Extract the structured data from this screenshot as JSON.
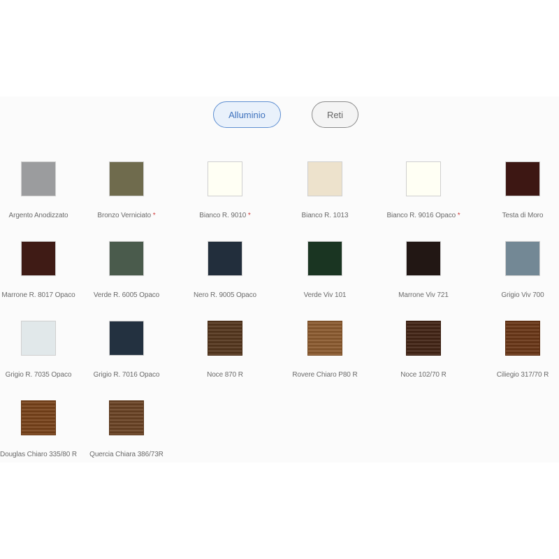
{
  "tabs": [
    {
      "label": "Alluminio",
      "active": true
    },
    {
      "label": "Reti",
      "active": false
    }
  ],
  "swatches": [
    {
      "label": "Argento Anodizzato",
      "color": "#9b9c9e",
      "star": false
    },
    {
      "label": "Bronzo Verniciato",
      "color": "#6f6b4d",
      "star": true
    },
    {
      "label": "Bianco R. 9010",
      "color": "#fffff4",
      "star": true
    },
    {
      "label": "Bianco R. 1013",
      "color": "#ede2cc",
      "star": false
    },
    {
      "label": "Bianco R. 9016 Opaco",
      "color": "#fffff4",
      "star": true
    },
    {
      "label": "Testa di Moro",
      "color": "#3d1713",
      "star": false
    },
    {
      "label": "Marrone R. 8017 Opaco",
      "color": "#3f1b15",
      "star": false
    },
    {
      "label": "Verde R. 6005 Opaco",
      "color": "#4a5b4c",
      "star": false
    },
    {
      "label": "Nero R. 9005 Opaco",
      "color": "#222e3c",
      "star": false
    },
    {
      "label": "Verde Viv 101",
      "color": "#1a3522",
      "star": false
    },
    {
      "label": "Marrone Viv 721",
      "color": "#221714",
      "star": false
    },
    {
      "label": "Grigio Viv 700",
      "color": "#738895",
      "star": false
    },
    {
      "label": "Grigio R. 7035 Opaco",
      "color": "#e1e8ea",
      "star": false
    },
    {
      "label": "Grigio R. 7016 Opaco",
      "color": "#233140",
      "star": false
    },
    {
      "label": "Noce 870 R",
      "color": "#5b3f28",
      "star": false,
      "wood": true
    },
    {
      "label": "Rovere Chiaro P80 R",
      "color": "#8d6038",
      "star": false,
      "wood": true
    },
    {
      "label": "Noce 102/70 R",
      "color": "#4a2e20",
      "star": false,
      "wood": true
    },
    {
      "label": "Ciliegio 317/70 R",
      "color": "#6e3f22",
      "star": false,
      "wood": true
    },
    {
      "label": "Douglas Chiaro 335/80 R",
      "color": "#7b4a25",
      "star": false,
      "wood": true
    },
    {
      "label": "Quercia Chiara 386/73R",
      "color": "#6e4a2e",
      "star": false,
      "wood": true
    }
  ]
}
